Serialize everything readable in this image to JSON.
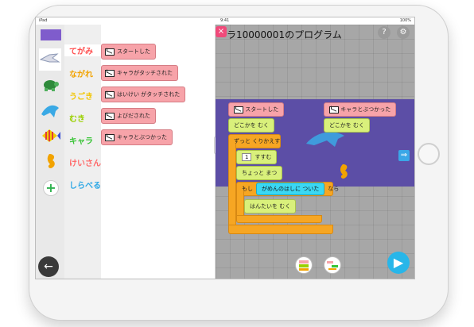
{
  "status": {
    "device": "iPad",
    "time": "9:41",
    "battery": "100%"
  },
  "colors": {
    "accent": "#f04a7a",
    "purple_band": "#5c4ea6",
    "event_block": "#f7a3a9",
    "motion_block": "#d9f07b",
    "control_block": "#f6a623",
    "sensor_block": "#3bd8f3"
  },
  "header": {
    "title": "ラ10000001のプログラム",
    "close_icon": "close-icon",
    "help_label": "?",
    "settings_icon": "gear-icon"
  },
  "tools": [
    "camera-icon",
    "pencil-icon",
    "gear-icon"
  ],
  "characters": [
    "bird",
    "turtle",
    "dolphin",
    "striped-fish",
    "seahorse"
  ],
  "add_label": "+",
  "back_label": "←",
  "categories": [
    {
      "label": "てがみ",
      "color": "#ff4d4d",
      "active": true
    },
    {
      "label": "ながれ",
      "color": "#f2a300"
    },
    {
      "label": "うごき",
      "color": "#f2c500"
    },
    {
      "label": "むき",
      "color": "#9ad000"
    },
    {
      "label": "キャラ",
      "color": "#38c436"
    },
    {
      "label": "けいさん",
      "color": "#ff6a6a"
    },
    {
      "label": "しらべる",
      "color": "#2ea8e6"
    }
  ],
  "palette": [
    "スタートした",
    "キャラがタッチされた",
    "はいけい がタッチされた",
    "よびだされた",
    "キャラとぶつかった"
  ],
  "program": {
    "event1": "スタートした",
    "face_dir": "どこかを むく",
    "loop": "ずっと くりかえす",
    "move_num": "1",
    "move_label": "すすむ",
    "wait": "ちょっと まつ",
    "if_label": "もし",
    "if_condition": "がめんのはしに ついた",
    "if_tail": "なら",
    "reverse": "はんたいを むく",
    "event2": "キャラとぶつかった",
    "face_dir2": "どこかを むく"
  },
  "stage_controls": {
    "scroll_arrow": "⇒",
    "play_icon": "▶"
  }
}
